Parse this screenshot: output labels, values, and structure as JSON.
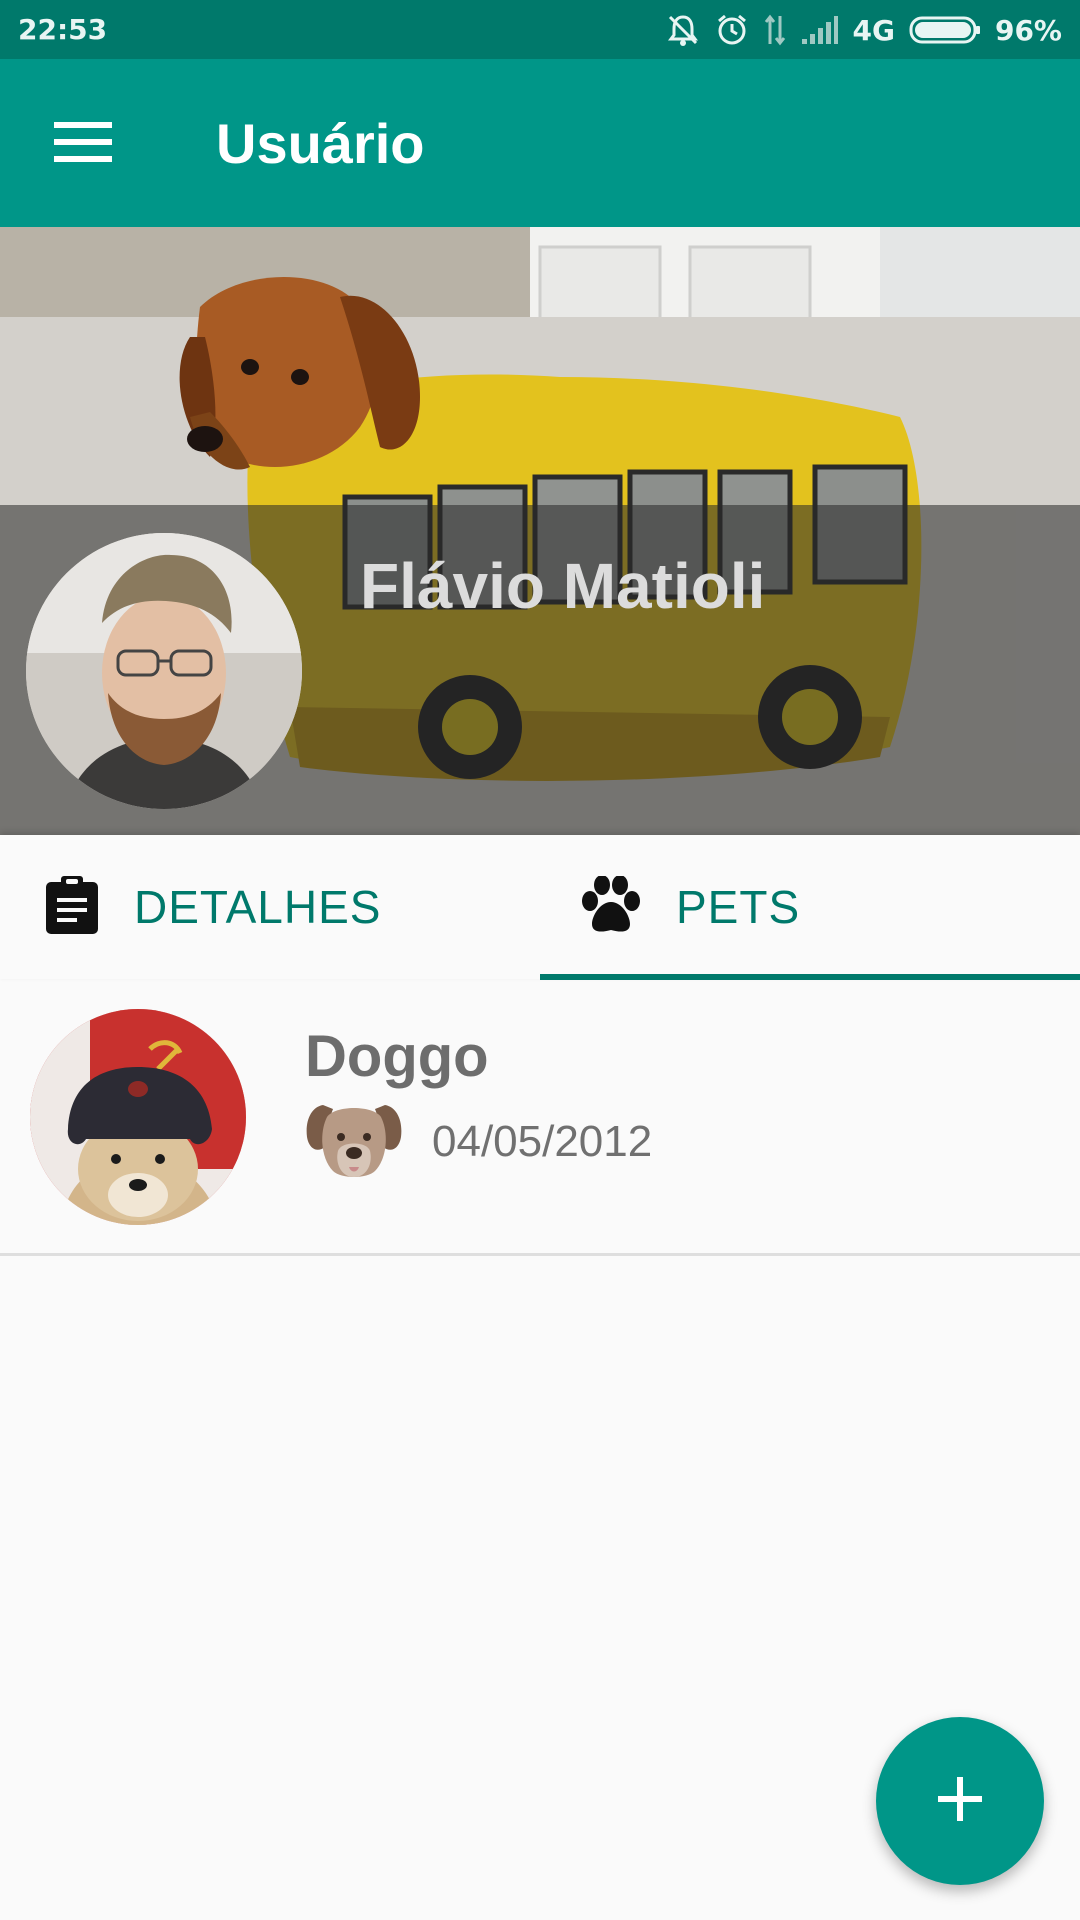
{
  "status_bar": {
    "time": "22:53",
    "network": "4G",
    "battery": "96%",
    "icons": [
      "mute-icon",
      "alarm-icon",
      "data-arrows-icon",
      "signal-icon",
      "battery-icon"
    ]
  },
  "app_bar": {
    "title": "Usuário",
    "menu_icon": "menu-icon"
  },
  "profile": {
    "name": "Flávio Matioli"
  },
  "tabs": [
    {
      "label": "DETALHES",
      "icon": "clipboard-icon",
      "selected": false
    },
    {
      "label": "PETS",
      "icon": "paw-icon",
      "selected": true
    }
  ],
  "pets": [
    {
      "name": "Doggo",
      "species_icon": "dog-face-icon",
      "birth_date": "04/05/2012"
    }
  ],
  "fab": {
    "icon": "add-icon"
  },
  "colors": {
    "primary": "#009688",
    "primary_dark": "#00796b",
    "background": "#fafafa"
  }
}
